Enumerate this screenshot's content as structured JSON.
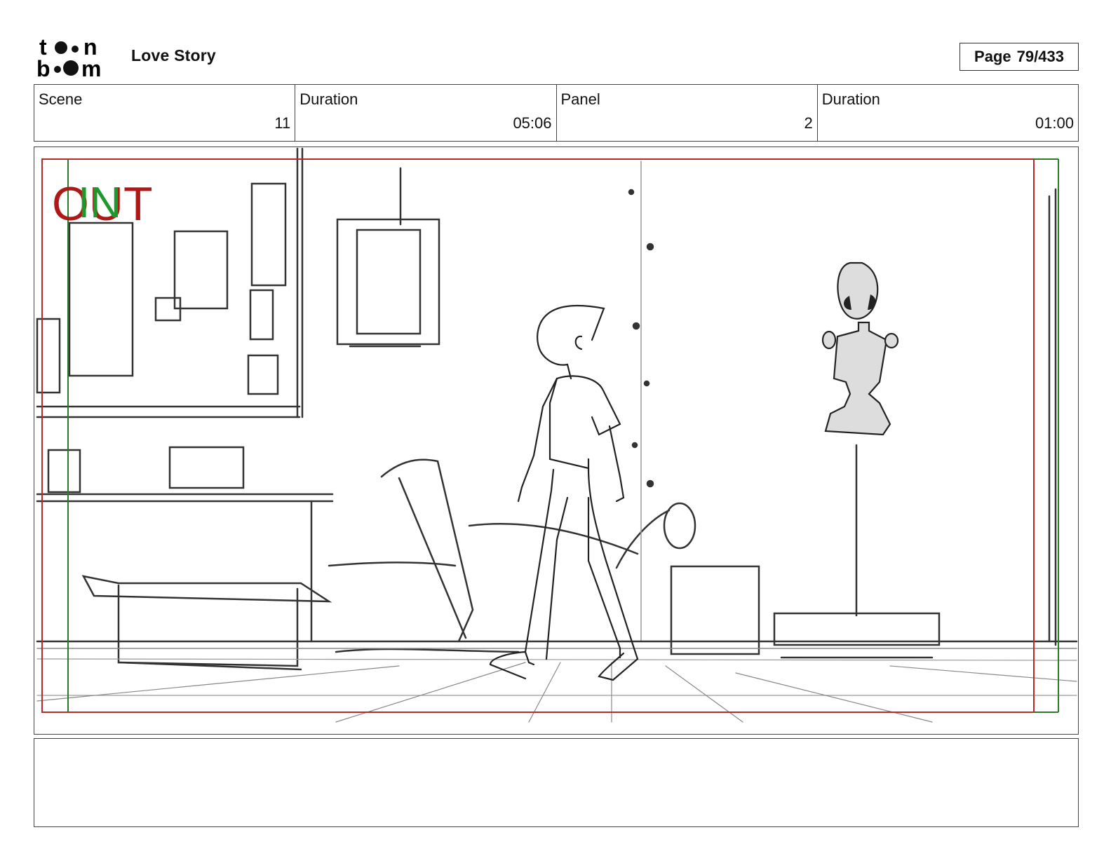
{
  "header": {
    "logo_text_top": "toon",
    "logo_text_bottom": "boom",
    "project_title": "Love Story",
    "page_label": "Page",
    "page_value": "79/433"
  },
  "info": {
    "scene_label": "Scene",
    "scene_value": "11",
    "scene_duration_label": "Duration",
    "scene_duration_value": "05:06",
    "panel_label": "Panel",
    "panel_value": "2",
    "panel_duration_label": "Duration",
    "panel_duration_value": "01:00"
  },
  "panel": {
    "overlay_out": "OUT",
    "overlay_in": "IN",
    "out_color": "#b01818",
    "in_color": "#1a9a2a",
    "frame_red": "#b52a2a",
    "frame_green": "#2a7a2a"
  },
  "notes": {
    "text": ""
  }
}
